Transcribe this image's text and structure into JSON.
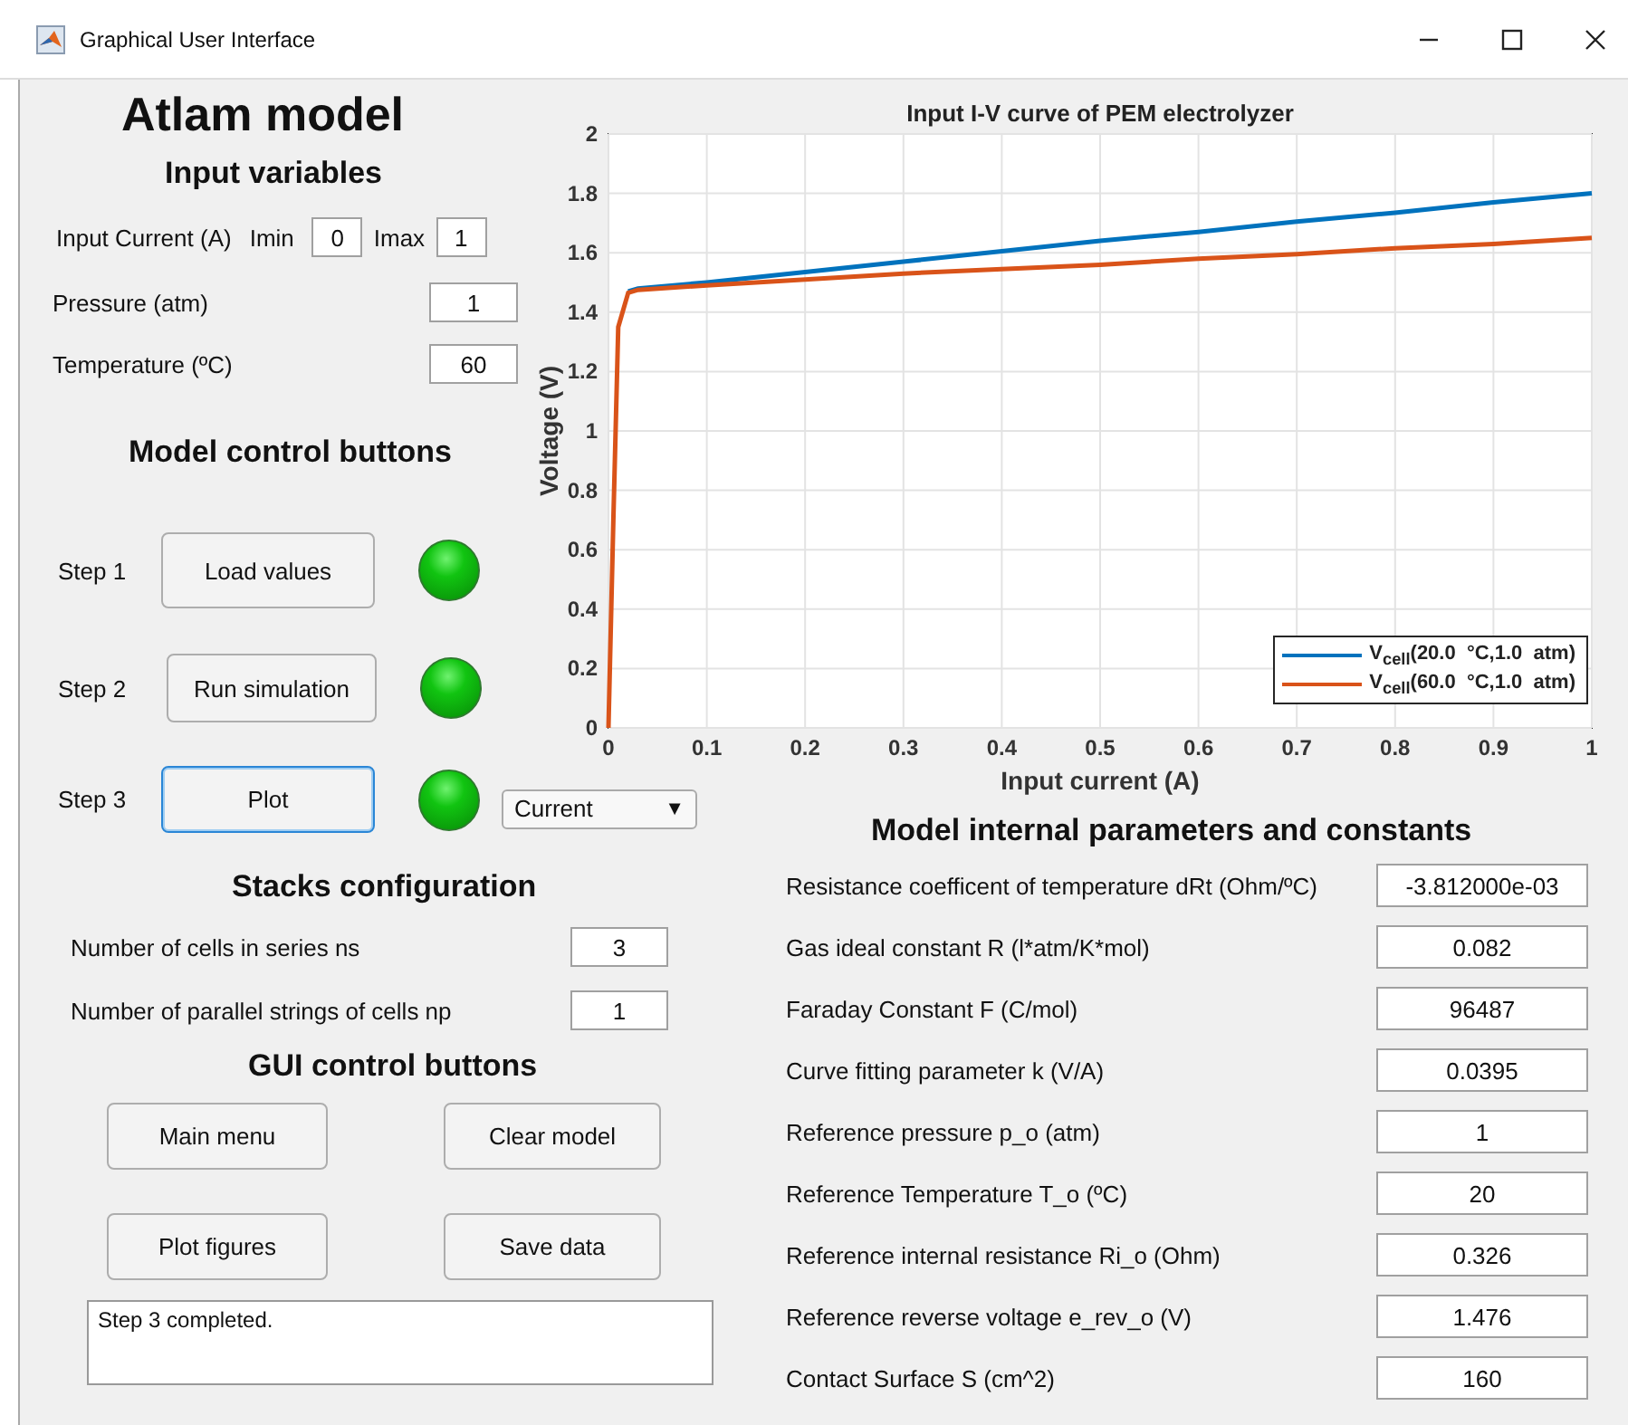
{
  "window": {
    "title": "Graphical User Interface"
  },
  "app_title": "Atlam model",
  "input_variables": {
    "heading": "Input variables",
    "current": {
      "label": "Input Current (A)",
      "min_label": "Imin",
      "min_value": "0",
      "max_label": "Imax",
      "max_value": "1"
    },
    "fields": [
      {
        "label": "Pressure (atm)",
        "value": "1"
      },
      {
        "label": "Temperature (ºC)",
        "value": "60"
      }
    ]
  },
  "model_controls": {
    "heading": "Model control buttons",
    "steps": [
      {
        "label": "Step 1",
        "button": "Load values",
        "focused": false,
        "on": true
      },
      {
        "label": "Step 2",
        "button": "Run simulation",
        "focused": false,
        "on": true
      },
      {
        "label": "Step 3",
        "button": "Plot",
        "focused": true,
        "on": true
      }
    ],
    "plot_select": {
      "value": "Current",
      "arrow": "▼"
    }
  },
  "stacks": {
    "heading": "Stacks configuration",
    "fields": [
      {
        "label": "Number of  cells in series ns",
        "value": "3"
      },
      {
        "label": "Number of parallel strings of cells np",
        "value": "1"
      }
    ]
  },
  "gui_controls": {
    "heading": "GUI control buttons",
    "buttons": [
      "Main menu",
      "Clear model",
      "Plot figures",
      "Save data"
    ]
  },
  "log": {
    "value": "Step 3 completed."
  },
  "chart": {
    "chart_data": {
      "type": "line",
      "title": "Input I-V curve of PEM electrolyzer",
      "xlabel": "Input current (A)",
      "ylabel": "Voltage (V)",
      "x": [
        0,
        0.005,
        0.01,
        0.02,
        0.03,
        0.1,
        0.2,
        0.3,
        0.4,
        0.5,
        0.6,
        0.7,
        0.8,
        0.9,
        1
      ],
      "series": [
        {
          "name": "V$_{cell}$(20.0  °C,1.0  atm)",
          "color": "#0072bd",
          "values": [
            null,
            null,
            null,
            1.47,
            1.48,
            1.5,
            1.535,
            1.57,
            1.605,
            1.64,
            1.67,
            1.705,
            1.735,
            1.77,
            1.8
          ]
        },
        {
          "name": "V$_{cell}$(60.0  °C,1.0  atm)",
          "color": "#d95319",
          "values": [
            0,
            0.7,
            1.35,
            1.465,
            1.475,
            1.49,
            1.51,
            1.53,
            1.545,
            1.56,
            1.58,
            1.595,
            1.615,
            1.63,
            1.65
          ]
        }
      ],
      "xlim": [
        0,
        1
      ],
      "ylim": [
        0,
        2
      ],
      "grid": true,
      "legend": true,
      "xticks": [
        0,
        0.1,
        0.2,
        0.3,
        0.4,
        0.5,
        0.6,
        0.7,
        0.8,
        0.9,
        1
      ],
      "yticks": [
        0,
        0.2,
        0.4,
        0.6,
        0.8,
        1,
        1.2,
        1.4,
        1.6,
        1.8,
        2
      ]
    }
  },
  "parameters": {
    "heading": "Model internal parameters and constants",
    "rows": [
      {
        "label": "Resistance coefficent of temperature dRt (Ohm/ºC)",
        "value": "-3.812000e-03"
      },
      {
        "label": "Gas ideal constant R (l*atm/K*mol)",
        "value": "0.082"
      },
      {
        "label": "Faraday Constant F (C/mol)",
        "value": "96487"
      },
      {
        "label": "Curve fitting parameter k (V/A)",
        "value": "0.0395"
      },
      {
        "label": "Reference pressure p_o (atm)",
        "value": "1"
      },
      {
        "label": "Reference Temperature T_o (ºC)",
        "value": "20"
      },
      {
        "label": "Reference internal resistance Ri_o (Ohm)",
        "value": "0.326"
      },
      {
        "label": "Reference reverse voltage e_rev_o (V)",
        "value": "1.476"
      },
      {
        "label": "Contact Surface S (cm^2)",
        "value": "160"
      }
    ]
  }
}
